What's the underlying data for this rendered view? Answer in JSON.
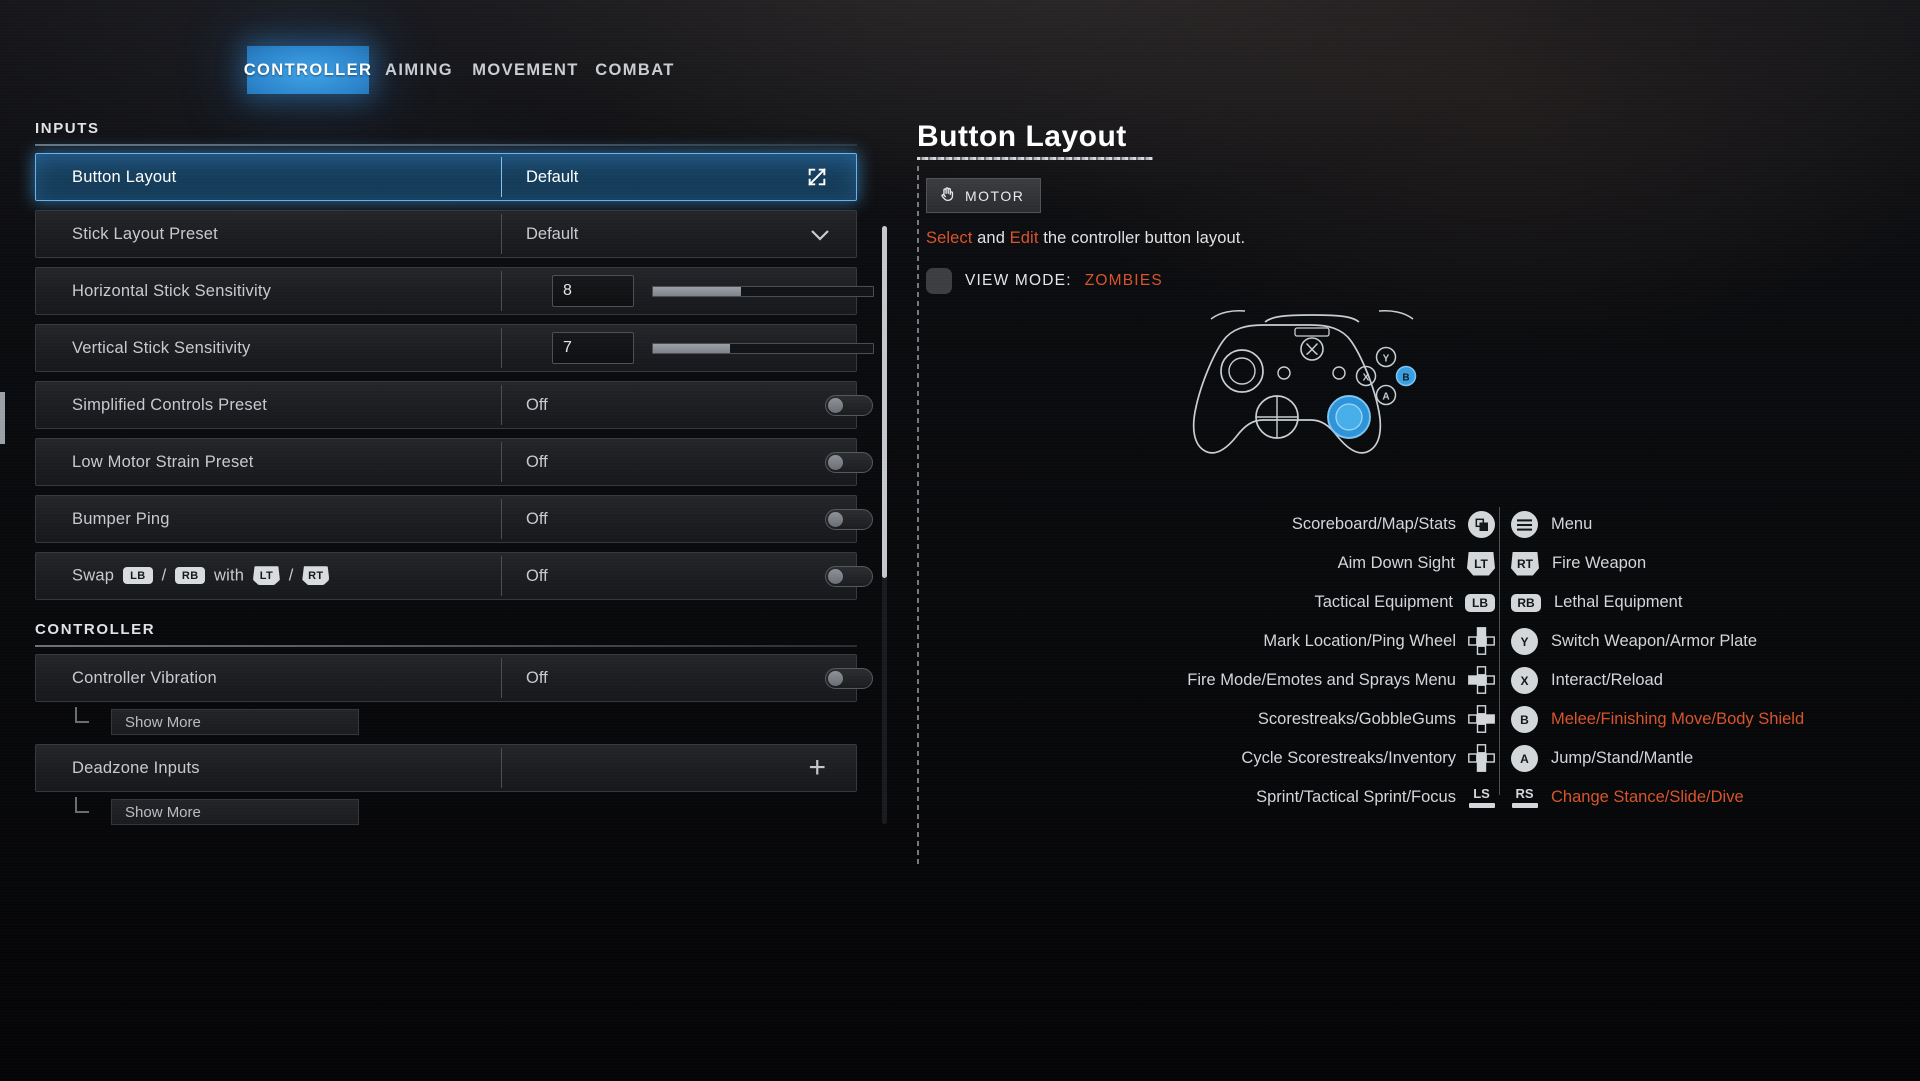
{
  "tabs": [
    {
      "label": "CONTROLLER",
      "active": true
    },
    {
      "label": "AIMING",
      "active": false
    },
    {
      "label": "MOVEMENT",
      "active": false
    },
    {
      "label": "COMBAT",
      "active": false
    }
  ],
  "sections": [
    {
      "title": "INPUTS",
      "rows": [
        {
          "label": "Button Layout",
          "value": "Default",
          "widget": "external",
          "selected": true
        },
        {
          "label": "Stick Layout Preset",
          "value": "Default",
          "widget": "chevron",
          "selected": false
        },
        {
          "label": "Horizontal Stick Sensitivity",
          "value": "8",
          "widget": "slider",
          "fill": 40,
          "selected": false
        },
        {
          "label": "Vertical Stick Sensitivity",
          "value": "7",
          "widget": "slider",
          "fill": 35,
          "selected": false
        },
        {
          "label": "Simplified Controls Preset",
          "value": "Off",
          "widget": "toggle",
          "selected": false
        },
        {
          "label": "Low Motor Strain Preset",
          "value": "Off",
          "widget": "toggle",
          "selected": false
        },
        {
          "label": "Bumper Ping",
          "value": "Off",
          "widget": "toggle",
          "selected": false
        },
        {
          "label": "Swap LB / RB with LT / RT",
          "value": "Off",
          "widget": "toggle",
          "selected": false,
          "rich": [
            {
              "t": "text",
              "v": "Swap "
            },
            {
              "t": "bumper",
              "v": "LB"
            },
            {
              "t": "text",
              "v": " / "
            },
            {
              "t": "bumper",
              "v": "RB"
            },
            {
              "t": "text",
              "v": " with "
            },
            {
              "t": "trigger",
              "v": "LT"
            },
            {
              "t": "text",
              "v": " / "
            },
            {
              "t": "trigger",
              "v": "RT"
            }
          ]
        }
      ]
    },
    {
      "title": "CONTROLLER",
      "rows": [
        {
          "label": "Controller Vibration",
          "value": "Off",
          "widget": "toggle",
          "selected": false,
          "sub": "Show More"
        },
        {
          "label": "Deadzone Inputs",
          "value": "",
          "widget": "plus",
          "selected": false,
          "sub": "Show More"
        }
      ]
    }
  ],
  "detail": {
    "title": "Button Layout",
    "motor_button": "MOTOR",
    "motor_icon": "hand-icon",
    "description": {
      "part1": "Select",
      "part2": " and ",
      "part3": "Edit",
      "part4": " the controller button layout."
    },
    "view_mode_label": "VIEW MODE:",
    "view_mode_value": "ZOMBIES",
    "controller_art": "xbox-controller-diagram",
    "mappings_left": [
      {
        "label": "Scoreboard/Map/Stats",
        "glyph": "view",
        "type": "circle",
        "hot": false
      },
      {
        "label": "Aim Down Sight",
        "glyph": "LT",
        "type": "trigger",
        "hot": false
      },
      {
        "label": "Tactical Equipment",
        "glyph": "LB",
        "type": "bumper",
        "hot": false
      },
      {
        "label": "Mark Location/Ping Wheel",
        "glyph": "dpad-up",
        "type": "dpad",
        "hot": false
      },
      {
        "label": "Fire Mode/Emotes and Sprays Menu",
        "glyph": "dpad-left",
        "type": "dpad",
        "hot": false
      },
      {
        "label": "Scorestreaks/GobbleGums",
        "glyph": "dpad-right",
        "type": "dpad",
        "hot": false
      },
      {
        "label": "Cycle Scorestreaks/Inventory",
        "glyph": "dpad-down",
        "type": "dpad",
        "hot": false
      },
      {
        "label": "Sprint/Tactical Sprint/Focus",
        "glyph": "LS",
        "type": "stick",
        "hot": false
      }
    ],
    "mappings_right": [
      {
        "label": "Menu",
        "glyph": "menu",
        "type": "circle",
        "hot": false
      },
      {
        "label": "Fire Weapon",
        "glyph": "RT",
        "type": "trigger",
        "hot": false
      },
      {
        "label": "Lethal Equipment",
        "glyph": "RB",
        "type": "bumper",
        "hot": false
      },
      {
        "label": "Switch Weapon/Armor Plate",
        "glyph": "Y",
        "type": "circle",
        "hot": false
      },
      {
        "label": "Interact/Reload",
        "glyph": "X",
        "type": "circle",
        "hot": false
      },
      {
        "label": "Melee/Finishing Move/Body Shield",
        "glyph": "B",
        "type": "circle",
        "hot": true
      },
      {
        "label": "Jump/Stand/Mantle",
        "glyph": "A",
        "type": "circle",
        "hot": false
      },
      {
        "label": "Change Stance/Slide/Dive",
        "glyph": "RS",
        "type": "stick",
        "hot": true
      }
    ]
  },
  "colors": {
    "accent_blue": "#2b82c8",
    "highlight_orange": "#d8542a",
    "text_primary": "#d2d6da",
    "panel_bg": "#1d1e22"
  }
}
